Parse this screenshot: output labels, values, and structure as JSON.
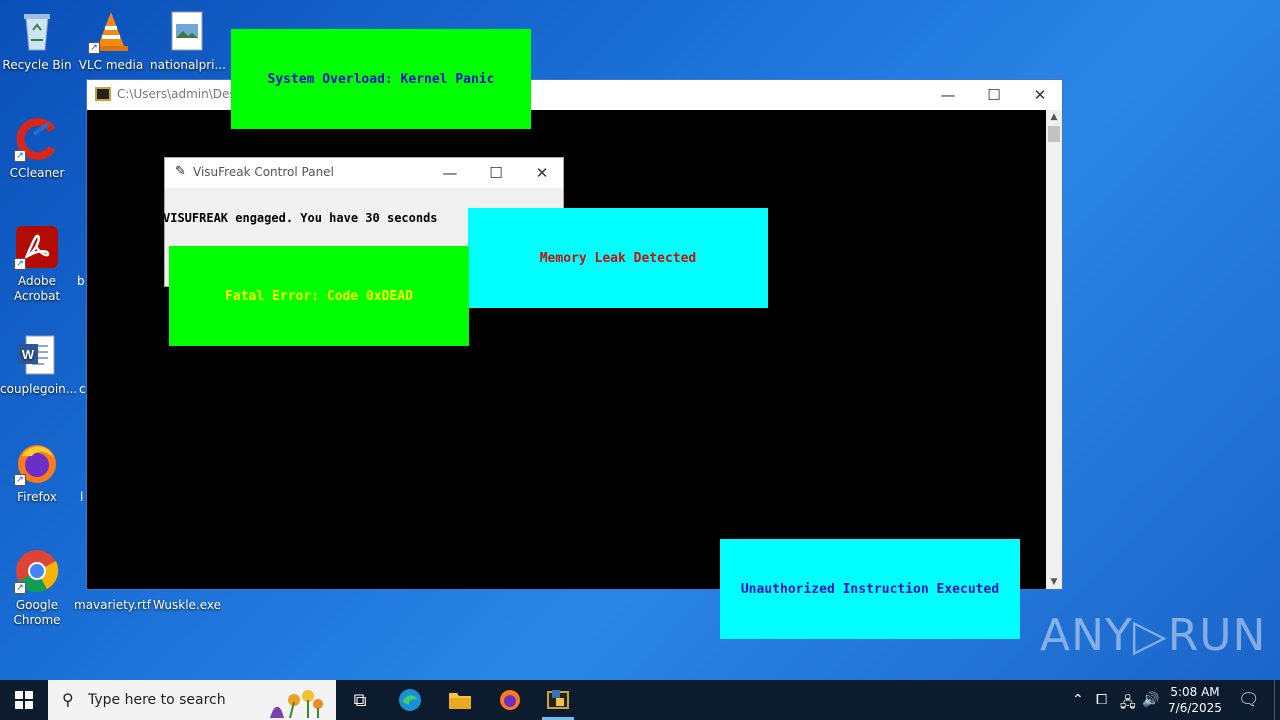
{
  "desktop": {
    "icons": [
      {
        "label": "Recycle Bin"
      },
      {
        "label": "VLC media"
      },
      {
        "label": "nationalpri..."
      },
      {
        "label": "CCleaner"
      },
      {
        "label": "Adobe Acrobat"
      },
      {
        "label": "couplegoin..."
      },
      {
        "label": "Firefox"
      },
      {
        "label": "Google Chrome"
      },
      {
        "label": "mavariety.rtf"
      },
      {
        "label": "Wuskle.exe"
      }
    ],
    "partial_labels": [
      "b",
      "c",
      "l"
    ]
  },
  "console_window": {
    "title": "C:\\Users\\admin\\Deskt",
    "minimize": "—",
    "maximize": "☐",
    "close": "✕"
  },
  "visufreak_window": {
    "title": "VisuFreak Control Panel",
    "message": "VISUFREAK engaged. You have 30 seconds",
    "minimize": "—",
    "maximize": "☐",
    "close": "✕"
  },
  "popups": [
    {
      "text": "System Overload: Kernel Panic",
      "bg": "#00ff00",
      "fg": "#1010c8"
    },
    {
      "text": "Memory Leak Detected",
      "bg": "#00ffff",
      "fg": "#c81010"
    },
    {
      "text": "Fatal Error: Code 0xDEAD",
      "bg": "#00ff00",
      "fg": "#ffff00"
    },
    {
      "text": "Unauthorized Instruction Executed",
      "bg": "#00ffff",
      "fg": "#1010c8"
    }
  ],
  "watermark": "ANY▷RUN",
  "taskbar": {
    "search_placeholder": "Type here to search",
    "time": "5:08 AM",
    "date": "7/6/2025"
  },
  "colors": {
    "taskbar_bg": "#0d1b2e",
    "desktop_bg": "#1a6fd6",
    "accent": "#76b9ed"
  }
}
